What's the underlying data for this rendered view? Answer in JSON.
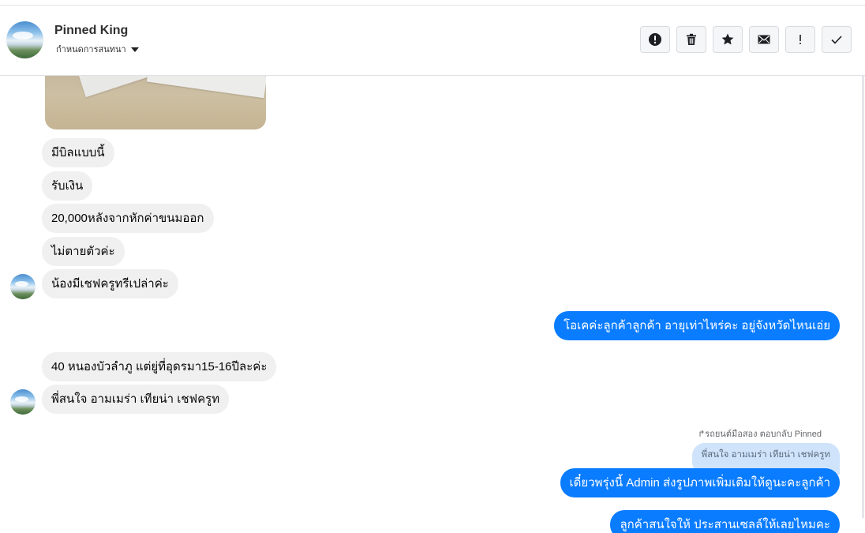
{
  "header": {
    "name": "Pinned King",
    "subtitle": "กำหนดการสนทนา",
    "toolbar_icons": [
      "alert-icon",
      "trash-icon",
      "star-icon",
      "mail-icon",
      "exclamation-icon",
      "check-icon"
    ]
  },
  "messages": {
    "m1": "มีบิลแบบนี้",
    "m2": "รับเงิน",
    "m3": "20,000หลังจากหักค่าขนมออก",
    "m4": "ไม่ตายตัวค่ะ",
    "m5": "น้องมีเชฟครูทรีเปล่าค่ะ",
    "o1": "โอเคค่ะลูกค้าลูกค้า อายุเท่าไหร่คะ อยู่จังหวัดไหนเอ่ย",
    "m6": "40 หนองบัวลำภู แต่ยู่ที่อุดรมา15-16ปีละค่ะ",
    "m7": "พี่สนใจ อามเมร่า เทียน่า เชฟครูท",
    "reply_label": "รถยนต์มือสอง ตอบกลับ Pinned",
    "reply_quote": "พี่สนใจ อามเมร่า เทียน่า เชฟครูท",
    "o2": "เดี๋ยวพรุ่งนี้ Admin ส่งรูปภาพเพิ่มเติมให้ดูนะคะลูกค้า",
    "o3": "ลูกค้าสนใจให้ ประสานเซลล์ให้เลยไหมคะ"
  },
  "colors": {
    "outgoing": "#0a7cff",
    "incoming": "#f0f0f0",
    "reply_quote": "#cfe3fb"
  }
}
